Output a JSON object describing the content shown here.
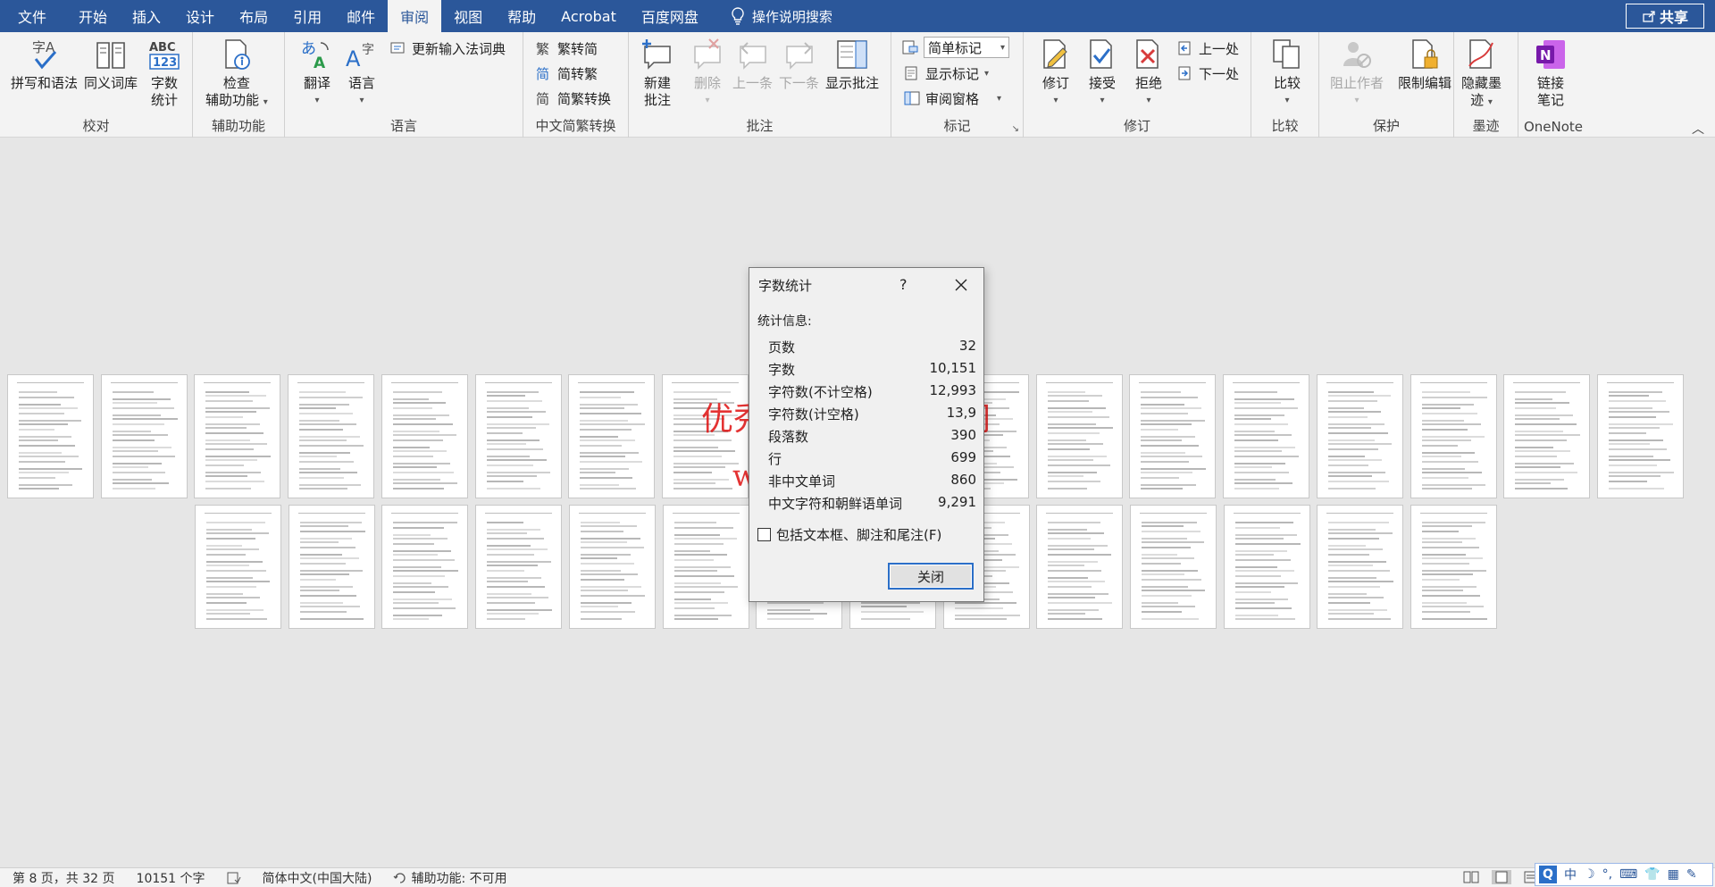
{
  "menu": {
    "tabs": [
      "文件",
      "开始",
      "插入",
      "设计",
      "布局",
      "引用",
      "邮件",
      "审阅",
      "视图",
      "帮助",
      "Acrobat",
      "百度网盘"
    ],
    "active": "审阅",
    "tell_me": "操作说明搜索",
    "share": "共享"
  },
  "ribbon": {
    "proofing": {
      "spelling": "拼写和语法",
      "thesaurus": "同义词库",
      "word_count_1": "字数",
      "word_count_2": "统计",
      "label": "校对"
    },
    "accessibility": {
      "check_1": "检查",
      "check_2": "辅助功能",
      "label": "辅助功能"
    },
    "language": {
      "translate": "翻译",
      "language": "语言",
      "update_ime": "更新输入法词典",
      "label": "语言"
    },
    "chinese": {
      "to_simplified": "繁转简",
      "to_traditional": "简转繁",
      "convert": "简繁转换",
      "label": "中文简繁转换"
    },
    "comments": {
      "new_1": "新建",
      "new_2": "批注",
      "delete": "删除",
      "prev": "上一条",
      "next": "下一条",
      "show": "显示批注",
      "label": "批注"
    },
    "tracking": {
      "markup_mode": "简单标记",
      "show_markup": "显示标记",
      "reviewing_pane": "审阅窗格",
      "track": "修订",
      "label": "标记"
    },
    "changes": {
      "accept": "接受",
      "reject": "拒绝",
      "previous": "上一处",
      "next": "下一处",
      "label": "修订"
    },
    "compare": {
      "compare": "比较",
      "label": "比较"
    },
    "protect": {
      "block_authors": "阻止作者",
      "restrict": "限制编辑",
      "label": "保护"
    },
    "ink": {
      "hide_1": "隐藏墨",
      "hide_2": "迹",
      "label": "墨迹"
    },
    "onenote": {
      "link_1": "链接",
      "link_2": "笔记",
      "label": "OneNote"
    }
  },
  "watermark": {
    "line1": "优秀毕业设计资源网",
    "line2": "www.keyicad.cn"
  },
  "dialog": {
    "title": "字数统计",
    "help": "?",
    "section": "统计信息:",
    "stats": [
      {
        "label": "页数",
        "value": "32"
      },
      {
        "label": "字数",
        "value": "10,151"
      },
      {
        "label": "字符数(不计空格)",
        "value": "12,993"
      },
      {
        "label": "字符数(计空格)",
        "value": "13,9"
      },
      {
        "label": "段落数",
        "value": "390"
      },
      {
        "label": "行",
        "value": "699"
      },
      {
        "label": "非中文单词",
        "value": "860"
      },
      {
        "label": "中文字符和朝鲜语单词",
        "value": "9,291"
      }
    ],
    "checkbox": "包括文本框、脚注和尾注(F)",
    "close": "关闭"
  },
  "status": {
    "page": "第 8 页，共 32 页",
    "words": "10151 个字",
    "language": "简体中文(中国大陆)",
    "accessibility": "辅助功能: 不可用"
  },
  "ime": {
    "mode": "中"
  }
}
